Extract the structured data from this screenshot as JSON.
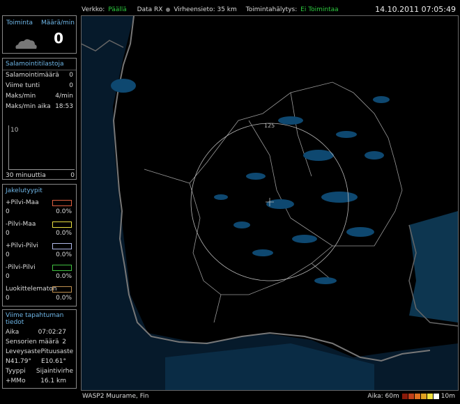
{
  "topbar": {
    "network_label": "Verkko:",
    "network_value": "Päällä",
    "data_rx_label": "Data RX",
    "error_label": "Virheensieto: 35 km",
    "alarm_label": "Toimintahälytys:",
    "alarm_value": "Ei Toimintaa",
    "datetime": "14.10.2011 07:05:49"
  },
  "activity": {
    "title": "Toiminta",
    "rate_label": "Määrä/min",
    "rate_value": "0",
    "icon": "cloud-icon"
  },
  "stats": {
    "title": "Salamointitilastoja",
    "rows": [
      {
        "label": "Salamointimäärä",
        "value": "0"
      },
      {
        "label": "Viime tunti",
        "value": "0"
      },
      {
        "label": "Maks/min",
        "value": "4/min"
      },
      {
        "label": "Maks/min aika",
        "value": "18:53"
      }
    ],
    "chart_tick": "10",
    "chart_left": "30",
    "chart_left_unit": "minuuttia",
    "chart_right": "0"
  },
  "distribution": {
    "title": "Jakelutyypit",
    "types": [
      {
        "name": "+Pilvi-Maa",
        "count": "0",
        "pct": "0.0%",
        "color": "#e06040"
      },
      {
        "name": "-Pilvi-Maa",
        "count": "0",
        "pct": "0.0%",
        "color": "#e8e040"
      },
      {
        "name": "+Pilvi-Pilvi",
        "count": "0",
        "pct": "0.0%",
        "color": "#b0b8e8"
      },
      {
        "name": "-Pilvi-Pilvi",
        "count": "0",
        "pct": "0.0%",
        "color": "#40c040"
      },
      {
        "name": "Luokittelematon",
        "count": "0",
        "pct": "0.0%",
        "color": "#c09050"
      }
    ]
  },
  "last_event": {
    "title": "Viime tapahtuman tiedot",
    "time_label": "Aika",
    "time_value": "07:02:27",
    "sensors_label": "Sensorien määrä",
    "sensors_value": "2",
    "lat_label": "Leveysaste",
    "lon_label": "Pituusaste",
    "lat_value": "N41.79°",
    "lon_value": "E10.61°",
    "type_label": "Tyyppi",
    "loc_err_label": "Sijaintivirhe",
    "type_value": "+MMo",
    "loc_err_value": "16.1 km"
  },
  "map": {
    "range_label": "125"
  },
  "bottombar": {
    "station": "WASP2 Muurame, Fin",
    "time_label": "Aika: 60m",
    "time_end": "10m",
    "colors": [
      "#8b1a0a",
      "#c0401a",
      "#e07020",
      "#e0a020",
      "#f0e040",
      "#ffffff"
    ]
  }
}
